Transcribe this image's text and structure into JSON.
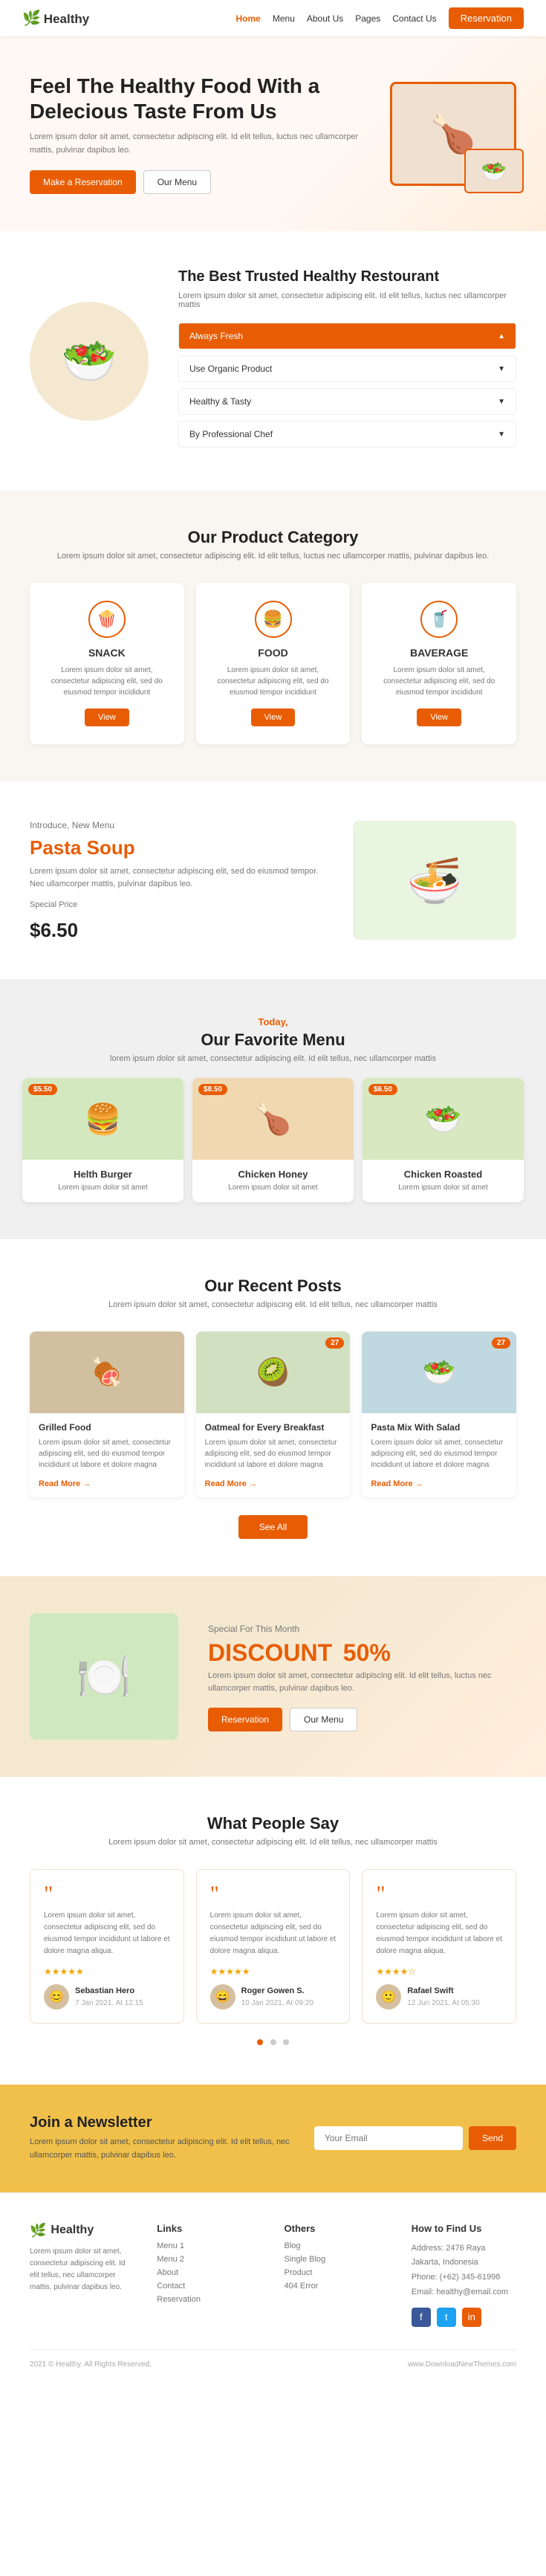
{
  "nav": {
    "logo": "Healthy",
    "links": [
      "Home",
      "Menu",
      "About Us",
      "Pages",
      "Contact Us"
    ],
    "cta": "Reservation"
  },
  "hero": {
    "title": "Feel The Healthy Food With a Delecious Taste From Us",
    "description": "Lorem ipsum dolor sit amet, consectetur adipiscing elit. Id elit tellus, luctus nec ullamcorper mattis, pulvinar dapibus leo.",
    "btn1": "Make a Reservation",
    "btn2": "Our Menu",
    "img_emoji": "🍗"
  },
  "trusted": {
    "title": "The Best Trusted Healthy Restourant",
    "description": "Lorem ipsum dolor sit amet, consectetur adipiscing elit. Id elit tellus, luctus nec ullamcorper mattis",
    "img_emoji": "🥗",
    "accordion": [
      {
        "label": "Always Fresh",
        "active": true
      },
      {
        "label": "Use Organic Product",
        "active": false
      },
      {
        "label": "Healthy & Tasty",
        "active": false
      },
      {
        "label": "By Professional Chef",
        "active": false
      }
    ]
  },
  "product_category": {
    "title": "Our Product Category",
    "description": "Lorem ipsum dolor sit amet, consectetur adipiscing elit. Id elit tellus, luctus nec ullamcorper mattis, pulvinar dapibus leo.",
    "cards": [
      {
        "icon": "🍿",
        "label": "SNACK",
        "description": "Lorem ipsum dolor sit amet, consectetur adipiscing elit, sed do eiusmod tempor incididunt",
        "btn": "View"
      },
      {
        "icon": "🍔",
        "label": "FOOD",
        "description": "Lorem ipsum dolor sit amet, consectetur adipiscing elit, sed do eiusmod tempor incididunt",
        "btn": "View"
      },
      {
        "icon": "🥤",
        "label": "BAVERAGE",
        "description": "Lorem ipsum dolor sit amet, consectetur adipiscing elit, sed do eiusmod tempor incididunt",
        "btn": "View"
      }
    ]
  },
  "new_menu": {
    "tag": "Introduce, New Menu",
    "title": "Pasta Soup",
    "description": "Lorem ipsum dolor sit amet, consectetur adipiscing elit, sed do eiusmod tempor. Nec ullamcorper mattis, pulvinar dapibus leo.",
    "special_label": "Special Price",
    "price": "$6.50",
    "img_emoji": "🍜"
  },
  "favorite_menu": {
    "today": "Today,",
    "title": "Our Favorite Menu",
    "description": "lorem ipsum dolor sit amet, consectetur adipiscing elit. Id elit tellus, nec ullamcorper mattis",
    "cards": [
      {
        "price": "$5.50",
        "img_emoji": "🍔",
        "name": "Helth Burger",
        "description": "Lorem ipsum dolor sit amet"
      },
      {
        "price": "$8.50",
        "img_emoji": "🍗",
        "name": "Chicken Honey",
        "description": "Lorem ipsum dolor sit amet"
      },
      {
        "price": "$6.50",
        "img_emoji": "🥗",
        "name": "Chicken Roasted",
        "description": "Lorem ipsum dolor sit amet"
      }
    ]
  },
  "recent_posts": {
    "title": "Our Recent Posts",
    "description": "Lorem ipsum dolor sit amet, consectetur adipiscing elit. Id elit tellus, nec ullamcorper mattis",
    "posts": [
      {
        "img_emoji": "🍖",
        "badge": "",
        "title": "Grilled Food",
        "description": "Lorem ipsum dolor sit amet, consectetur adipiscing elit, sed do eiusmod tempor incididunt ut labore et dolore magna",
        "read_more": "Read More →"
      },
      {
        "img_emoji": "🥝",
        "badge": "27",
        "title": "Oatmeal for Every Breakfast",
        "description": "Lorem ipsum dolor sit amet, consectetur adipiscing elit, sed do eiusmod tempor incididunt ut labore et dolore magna",
        "read_more": "Read More →"
      },
      {
        "img_emoji": "🥗",
        "badge": "27",
        "title": "Pasta Mix With Salad",
        "description": "Lorem ipsum dolor sit amet, consectetur adipiscing elit, sed do eiusmod tempor incididunt ut labore et dolore magna",
        "read_more": "Read More →"
      }
    ],
    "see_all": "See All"
  },
  "discount": {
    "tag": "Special For This Month",
    "title_pre": "DISCOUNT",
    "title_highlight": "50%",
    "description": "Lorem ipsum dolor sit amet, consectetur adipiscing elit. Id elit tellus, luctus nec ullamcorper mattis, pulvinar dapibus leo.",
    "btn1": "Reservation",
    "btn2": "Our Menu",
    "img_emoji": "🍽️"
  },
  "testimonials": {
    "title": "What People Say",
    "description": "Lorem ipsum dolor sit amet, consectetur adipiscing elit. Id elit tellus, nec ullamcorper mattis",
    "cards": [
      {
        "text": "Lorem ipsum dolor sit amet, consectetur adipiscing elit, sed do eiusmod tempor incididunt ut labore et dolore magna aliqua.",
        "stars": 5,
        "person": "Sebastian Hero",
        "date": "7 Jan 2021, At 12:15",
        "avatar": "😊"
      },
      {
        "text": "Lorem ipsum dolor sit amet, consectetur adipiscing elit, sed do eiusmod tempor incididunt ut labore et dolore magna aliqua.",
        "stars": 5,
        "person": "Roger Gowen S.",
        "date": "10 Jan 2021, At 09:20",
        "avatar": "😄"
      },
      {
        "text": "Lorem ipsum dolor sit amet, consectetur adipiscing elit, sed do eiusmod tempor incididunt ut labore et dolore magna aliqua.",
        "stars": 4,
        "person": "Rafael Swift",
        "date": "12 Jun 2021, At 05:30",
        "avatar": "🙂"
      }
    ]
  },
  "newsletter": {
    "title": "Join a Newsletter",
    "description": "Lorem ipsum dolor sit amet, consectetur adipiscing elit. Id elit tellus, nec ullamcorper mattis, pulvinar dapibus leo.",
    "placeholder": "Your Email",
    "btn": "Send"
  },
  "footer": {
    "logo": "Healthy",
    "description": "Lorem ipsum dolor sit amet, consectetur adipiscing elit. Id elit tellus, nec ullamcorper mattis, pulvinar dapibus leo.",
    "links_title": "Links",
    "links": [
      "Menu 1",
      "Menu 2",
      "About",
      "Contact",
      "Reservation"
    ],
    "others_title": "Others",
    "others": [
      "Blog",
      "Single Blog",
      "Product",
      "404 Error"
    ],
    "find_us_title": "How to Find Us",
    "address": "Address: 2476 Raya Jakarta, Indonesia",
    "phone": "Phone: (+62) 345-61998",
    "email": "Email: healthy@email.com",
    "copyright": "2021 © Healthy. All Rights Reserved.",
    "watermark": "www.DownloadNewThemes.com"
  }
}
